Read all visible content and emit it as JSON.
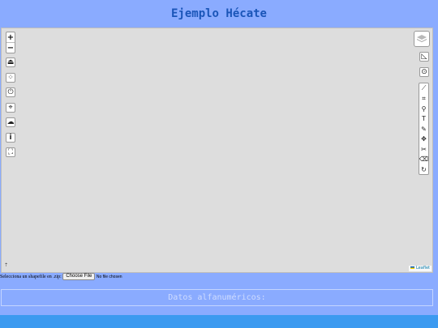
{
  "title": "Ejemplo Hécate",
  "map": {
    "zoom_in": "+",
    "zoom_out": "−",
    "left_controls": [
      {
        "name": "upload-icon",
        "glyph": "⏏"
      },
      {
        "name": "spinner-icon",
        "glyph": "⁘"
      },
      {
        "name": "power-icon",
        "glyph": "⏻"
      },
      {
        "name": "locate-icon",
        "glyph": "⌖"
      },
      {
        "name": "cloud-icon",
        "glyph": "☁"
      },
      {
        "name": "info-icon",
        "glyph": "i"
      },
      {
        "name": "fullscreen-icon",
        "glyph": "⛶"
      }
    ],
    "right_controls": [
      {
        "name": "measure-icon",
        "glyph": "◺"
      },
      {
        "name": "target-icon",
        "glyph": "⊙"
      }
    ],
    "draw_tools": [
      {
        "name": "polyline-icon",
        "glyph": "⟋"
      },
      {
        "name": "rectangle-icon",
        "glyph": "⌗"
      },
      {
        "name": "marker-icon",
        "glyph": "⚲"
      },
      {
        "name": "text-icon",
        "glyph": "T"
      },
      {
        "name": "edit-icon",
        "glyph": "✎"
      },
      {
        "name": "move-icon",
        "glyph": "✥"
      },
      {
        "name": "cut-icon",
        "glyph": "✂"
      },
      {
        "name": "eraser-icon",
        "glyph": "⌫"
      },
      {
        "name": "rotate-icon",
        "glyph": "↻"
      }
    ],
    "attribution": "Leaflet",
    "scale": "⇡"
  },
  "file_input": {
    "label": "Selecciona un shapefile en .zip:",
    "button": "Choose File",
    "status": "No file chosen"
  },
  "datos": "Datos alfanuméricos:"
}
